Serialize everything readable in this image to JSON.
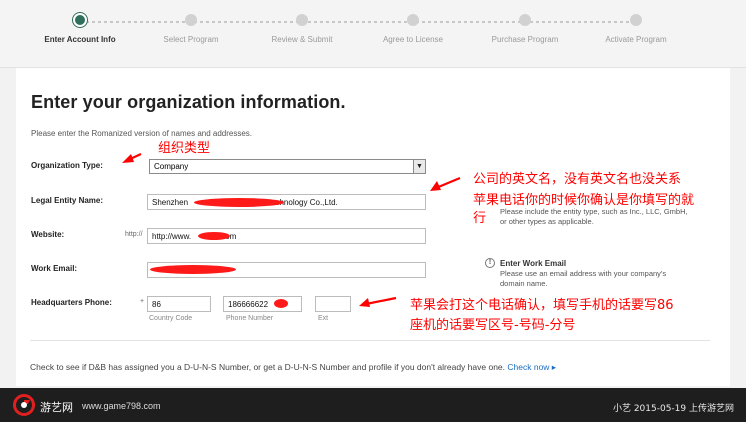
{
  "progress": {
    "steps": [
      {
        "label": "Enter Account Info",
        "active": true
      },
      {
        "label": "Select Program",
        "active": false
      },
      {
        "label": "Review & Submit",
        "active": false
      },
      {
        "label": "Agree to License",
        "active": false
      },
      {
        "label": "Purchase Program",
        "active": false
      },
      {
        "label": "Activate Program",
        "active": false
      }
    ]
  },
  "form": {
    "title": "Enter your organization information.",
    "intro": "Please enter the Romanized version of names and addresses.",
    "org_type": {
      "label": "Organization Type:",
      "value": "Company"
    },
    "legal_name": {
      "label": "Legal Entity Name:",
      "value_prefix": "Shenzhen",
      "value_suffix": "echnology Co.,Ltd."
    },
    "website": {
      "label": "Website:",
      "prefix": "http://",
      "value_prefix": "http://www.",
      "value_suffix": "com"
    },
    "work_email": {
      "label": "Work Email:",
      "value": ""
    },
    "phone": {
      "label": "Headquarters Phone:",
      "plus": "+",
      "country_code": "86",
      "country_code_label": "Country Code",
      "number": "186666622",
      "number_label": "Phone Number",
      "ext": "",
      "ext_label": "Ext"
    },
    "help_legal": {
      "lines": [
        "Please include the entity type, such as Inc., LLC, GmbH,",
        "or other types as applicable."
      ]
    },
    "help_email": {
      "title": "Enter Work Email",
      "lines": [
        "Please use an email address with your company's",
        "domain name."
      ]
    },
    "duns_text": "Check to see if D&B has assigned you a D-U-N-S Number, or get a D-U-N-S Number and profile if you don't already have one.",
    "duns_link": "Check now ▸"
  },
  "annotations": {
    "org_type": "组织类型",
    "legal_name_line1": "公司的英文名，没有英文名也没关系",
    "legal_name_line2": "苹果电话你的时候你确认是你填写的就",
    "legal_name_line3": "行",
    "phone_line1": "苹果会打这个电话确认，填写手机的话要写86",
    "phone_line2": "座机的话要写区号-号码-分号",
    "color": "#ff0000"
  },
  "footer": {
    "logo_text": "游艺网",
    "logo_url": "www.game798.com",
    "watermark": "小艺 2015-05-19 上传游艺网"
  }
}
